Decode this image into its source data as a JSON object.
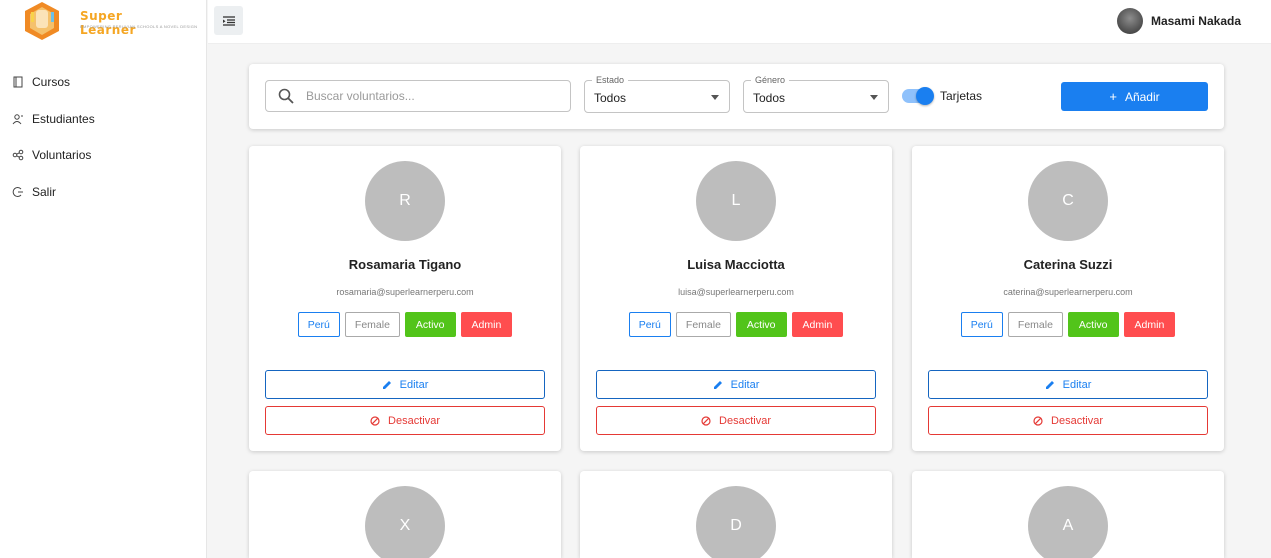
{
  "brand": {
    "name": "Super Learner",
    "tagline": "EMPOWERING PERUVIAN SCHOOLS A NOVEL DESIGN"
  },
  "sidebar": {
    "items": [
      {
        "label": "Cursos",
        "icon": "book-icon"
      },
      {
        "label": "Estudiantes",
        "icon": "students-icon"
      },
      {
        "label": "Voluntarios",
        "icon": "volunteers-icon"
      },
      {
        "label": "Salir",
        "icon": "logout-icon"
      }
    ]
  },
  "topbar": {
    "user_name": "Masami Nakada"
  },
  "filters": {
    "search_placeholder": "Buscar voluntarios...",
    "estado_label": "Estado",
    "estado_value": "Todos",
    "genero_label": "Género",
    "genero_value": "Todos",
    "toggle_label": "Tarjetas",
    "toggle_on": true,
    "add_label": "Añadir"
  },
  "cards": [
    {
      "initial": "R",
      "name": "Rosamaria Tigano",
      "email": "rosamaria@superlearnerperu.com",
      "country": "Perú",
      "gender": "Female",
      "status": "Activo",
      "role": "Admin",
      "edit": "Editar",
      "deactivate": "Desactivar"
    },
    {
      "initial": "L",
      "name": "Luisa Macciotta",
      "email": "luisa@superlearnerperu.com",
      "country": "Perú",
      "gender": "Female",
      "status": "Activo",
      "role": "Admin",
      "edit": "Editar",
      "deactivate": "Desactivar"
    },
    {
      "initial": "C",
      "name": "Caterina Suzzi",
      "email": "caterina@superlearnerperu.com",
      "country": "Perú",
      "gender": "Female",
      "status": "Activo",
      "role": "Admin",
      "edit": "Editar",
      "deactivate": "Desactivar"
    },
    {
      "initial": "X"
    },
    {
      "initial": "D"
    },
    {
      "initial": "A"
    }
  ],
  "colors": {
    "primary": "#1a7ff0",
    "success": "#52c41a",
    "danger": "#ff4d4f",
    "avatar_bg": "#bdbdbd"
  }
}
